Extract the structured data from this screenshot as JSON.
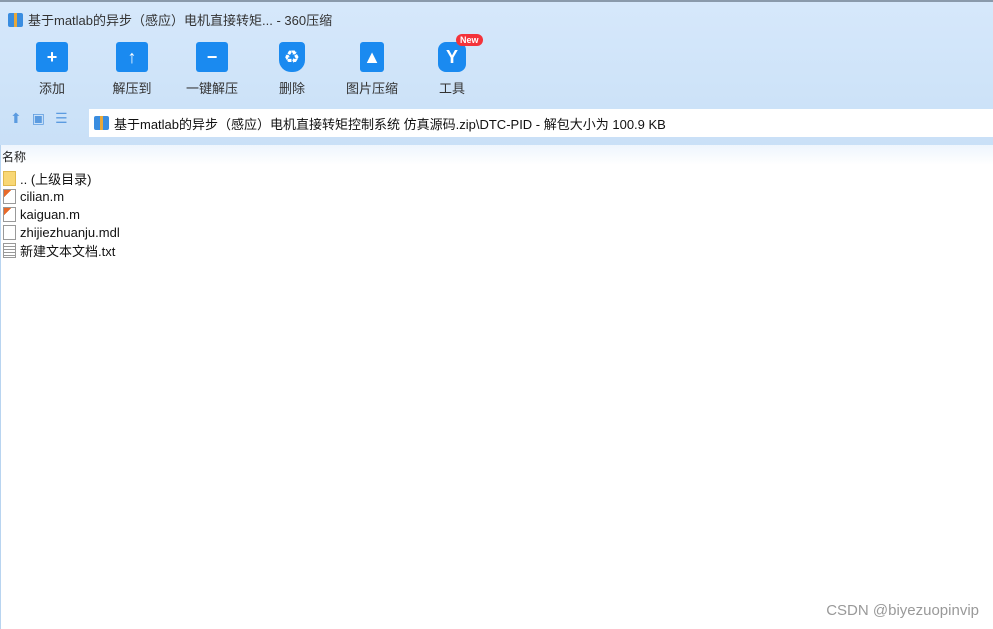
{
  "window": {
    "title": "基于matlab的异步（感应）电机直接转矩... - 360压缩"
  },
  "toolbar": [
    {
      "label": "添加",
      "icon": "add-folder-icon",
      "glyph": "+"
    },
    {
      "label": "解压到",
      "icon": "extract-to-icon",
      "glyph": "↑"
    },
    {
      "label": "一键解压",
      "icon": "one-click-extract-icon",
      "glyph": "−"
    },
    {
      "label": "删除",
      "icon": "recycle-bin-icon",
      "glyph": "♻"
    },
    {
      "label": "图片压缩",
      "icon": "image-compress-icon",
      "glyph": "▲"
    },
    {
      "label": "工具",
      "icon": "tools-icon",
      "glyph": "Y"
    }
  ],
  "new_badge": "New",
  "address": "基于matlab的异步（感应）电机直接转矩控制系统 仿真源码.zip\\DTC-PID - 解包大小为 100.9 KB",
  "columns": {
    "name": "名称"
  },
  "files": [
    {
      "name": ".. (上级目录)",
      "type": "folder"
    },
    {
      "name": "cilian.m",
      "type": "m"
    },
    {
      "name": "kaiguan.m",
      "type": "m"
    },
    {
      "name": "zhijiezhuanju.mdl",
      "type": "mdl"
    },
    {
      "name": "新建文本文档.txt",
      "type": "txt"
    }
  ],
  "watermark": "CSDN @biyezuopinvip"
}
